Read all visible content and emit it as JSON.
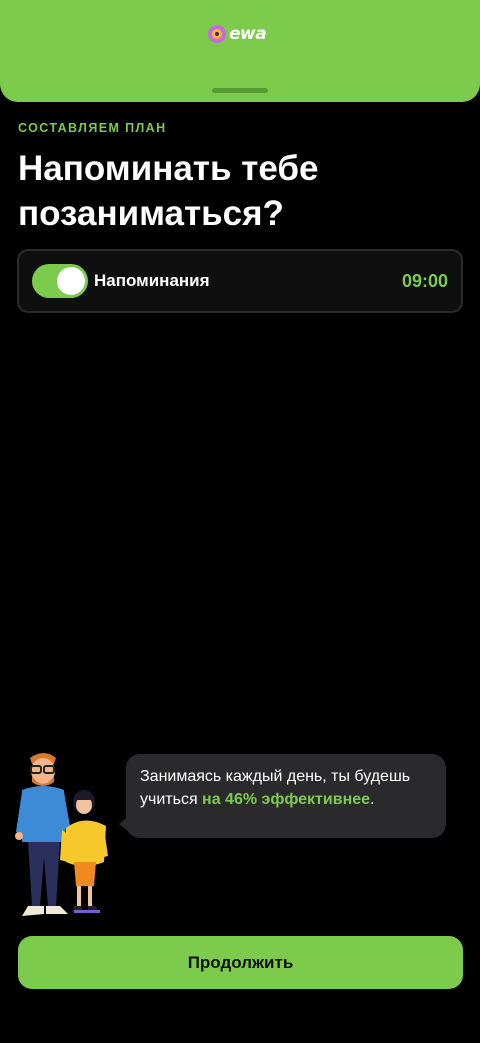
{
  "header": {
    "logo_text": "ewa",
    "accent_color": "#7ccb4c"
  },
  "step": {
    "eyebrow": "СОСТАВЛЯЕМ ПЛАН",
    "title": "Напоминать тебе позаниматься?"
  },
  "reminder": {
    "label": "Напоминания",
    "enabled": true,
    "time": "09:00"
  },
  "tip": {
    "text_before": "Занимаясь каждый день, ты будешь учиться ",
    "highlight": "на 46% эффективнее",
    "text_after": "."
  },
  "footer": {
    "continue_label": "Продолжить"
  }
}
